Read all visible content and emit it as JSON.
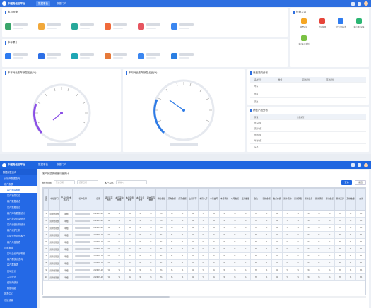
{
  "top": {
    "brand": "中国电信云平台",
    "tabs": [
      "数据看板",
      "数据门户"
    ],
    "sections": {
      "kpi1": "本月运营",
      "kpi2": "本年累计",
      "quick": "快捷入口",
      "gauge1": "本年对比去年销量占比(%)",
      "gauge2": "本月对比去年销量占比(%)",
      "table1": "商品流向分布",
      "table2": "销售产品分布"
    },
    "quick_items": [
      "开票申请",
      "合同管理",
      "发货计划申请",
      "客户拜访记录",
      "客户年度规划"
    ],
    "table1_head": [
      "品类型号",
      "数量",
      "同比增长",
      "环比增长"
    ],
    "table1_rows": [
      "华东",
      "华南",
      "西北"
    ],
    "table2_head": [
      "区域",
      "产品类型"
    ],
    "table2_rows": [
      "华东地区",
      "西南地区",
      "华中地区",
      "华北地区",
      "东北"
    ],
    "kpi1_colors": [
      "#3aa56b",
      "#f1a83a",
      "#27a89a",
      "#f06a3a",
      "#e65560",
      "#3b86f0"
    ],
    "kpi2_colors": [
      "#2f7cf0",
      "#2d6fe6",
      "#1fa6b4",
      "#e67a3a",
      "#3b86f0",
      "#2b7fe3"
    ]
  },
  "bottom": {
    "brand": "中国电信云平台",
    "nav": [
      "数据看板",
      "数据门户"
    ],
    "sidebar_title": "数据报表查询",
    "sidebar": [
      {
        "label": "分销商数据查询",
        "level": 1
      },
      {
        "label": "客户报表",
        "level": 1
      },
      {
        "label": "客户购买明细",
        "level": 2
      },
      {
        "label": "客户销量汇总",
        "level": 2
      },
      {
        "label": "客户数据综合",
        "level": 2
      },
      {
        "label": "客户数据信息",
        "level": 2
      },
      {
        "label": "客户库存数据统计",
        "level": 2
      },
      {
        "label": "客户拜访记录统计",
        "level": 2
      },
      {
        "label": "客户经营分析统计",
        "level": 2
      },
      {
        "label": "客户维护分析",
        "level": 2
      },
      {
        "label": "区域分布对比客户",
        "level": 2
      },
      {
        "label": "客户月度报表",
        "level": 2
      },
      {
        "label": "月度报表",
        "level": 1
      },
      {
        "label": "区域企业产品明细",
        "level": 2
      },
      {
        "label": "客户群统计查询",
        "level": 2
      },
      {
        "label": "客户群报表",
        "level": 2
      },
      {
        "label": "区域统计",
        "level": 2
      },
      {
        "label": "人员统计",
        "level": 2
      },
      {
        "label": "经销商统计",
        "level": 2
      },
      {
        "label": "数据明细",
        "level": 2
      },
      {
        "label": "报表中心",
        "level": 1
      },
      {
        "label": "系统设置",
        "level": 1
      }
    ],
    "breadcrumb": "客户销量多维度月度统计",
    "filters": {
      "date_label": "统计时间",
      "date_start": "开始日期",
      "date_end": "结束日期",
      "customer_label": "客户名称",
      "customer_placeholder": "请输入",
      "search": "查询",
      "reset": "重置"
    },
    "columns": [
      "序号",
      "单位部门",
      "产品类别/规格型号",
      "客户名称",
      "日期",
      "期初库存数量",
      "本月采购数量",
      "本月销售数量",
      "本月退货数量",
      "期末库存数量",
      "销售金额",
      "采购金额",
      "库存金额",
      "上月库存",
      "本月入库",
      "本月出库",
      "本月调拨",
      "本月盘点",
      "差异数量",
      "备注",
      "调拨金额",
      "盘点金额",
      "累计采购",
      "累计销售",
      "累计退货",
      "累计调拨",
      "累计盘点",
      "累计差异",
      "其他数量",
      "合计"
    ],
    "rows": [
      {
        "no": "1",
        "dept": "营销管理部",
        "product": "明细",
        "date": "2023-07-18"
      },
      {
        "no": "2",
        "dept": "营销管理部",
        "product": "明细",
        "date": "2023-07-18"
      },
      {
        "no": "3",
        "dept": "营销管理部",
        "product": "明细",
        "date": "2023-07-18"
      },
      {
        "no": "4",
        "dept": "营销管理部",
        "product": "明细",
        "date": "2023-07-18"
      },
      {
        "no": "5",
        "dept": "营销管理部",
        "product": "明细",
        "date": "2023-07-18"
      },
      {
        "no": "6",
        "dept": "营销管理部",
        "product": "明细",
        "date": "2023-07-18"
      },
      {
        "no": "7",
        "dept": "营销管理部",
        "product": "明细",
        "date": "2023-07-18"
      },
      {
        "no": "8",
        "dept": "营销管理部",
        "product": "明细",
        "date": "2023-07-18"
      },
      {
        "no": "9",
        "dept": "营销管理部",
        "product": "明细",
        "date": "2023-07-18"
      },
      {
        "no": "10",
        "dept": "营销管理部",
        "product": "明细",
        "date": "2023-07-18"
      }
    ],
    "cell_value": "%"
  }
}
